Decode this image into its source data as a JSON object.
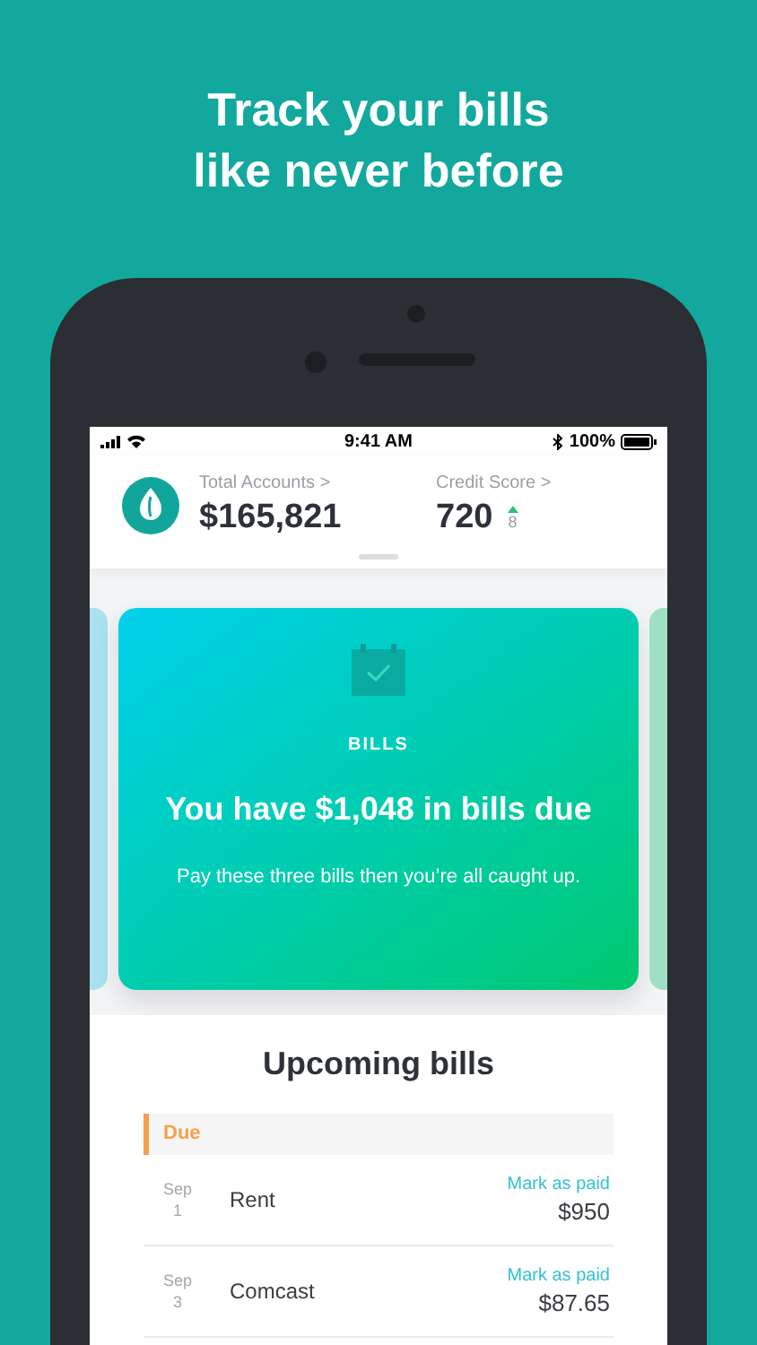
{
  "headline": [
    "Track your bills",
    "like never before"
  ],
  "status_bar": {
    "time": "9:41 AM",
    "battery": "100%"
  },
  "header": {
    "accounts": {
      "label": "Total Accounts",
      "chevron": ">",
      "value": "$165,821"
    },
    "credit": {
      "label": "Credit Score",
      "chevron": ">",
      "value": "720",
      "change": "8"
    }
  },
  "card": {
    "label": "BILLS",
    "title": "You have $1,048 in bills due",
    "subtitle": "Pay these three bills then you’re all caught up."
  },
  "upcoming": {
    "title": "Upcoming bills",
    "group": "Due",
    "bills": [
      {
        "month": "Sep",
        "day": "1",
        "name": "Rent",
        "action": "Mark as paid",
        "amount": "$950"
      },
      {
        "month": "Sep",
        "day": "3",
        "name": "Comcast",
        "action": "Mark as paid",
        "amount": "$87.65"
      }
    ]
  }
}
